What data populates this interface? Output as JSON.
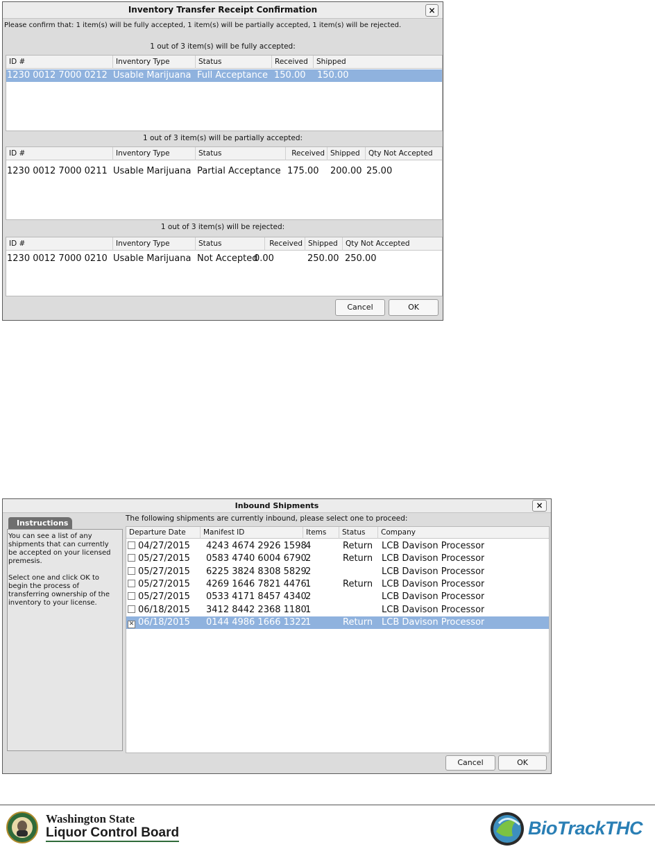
{
  "receipt_dialog": {
    "title": "Inventory Transfer Receipt Confirmation",
    "close": "×",
    "message": "Please confirm that: 1 item(s) will be fully accepted, 1 item(s) will be partially accepted, 1 item(s) will be rejected.",
    "sections": [
      {
        "label": "1 out of 3 item(s) will be fully accepted:",
        "columns": [
          "ID #",
          "Inventory Type",
          "Status",
          "Received",
          "Shipped"
        ],
        "rows": [
          [
            "1230 0012 7000 0212",
            "Usable Marijuana",
            "Full Acceptance",
            "150.00",
            "150.00"
          ]
        ]
      },
      {
        "label": "1 out of 3 item(s) will be partially accepted:",
        "columns": [
          "ID #",
          "Inventory Type",
          "Status",
          "Received",
          "Shipped",
          "Qty Not Accepted"
        ],
        "rows": [
          [
            "1230 0012 7000 0211",
            "Usable Marijuana",
            "Partial Acceptance",
            "175.00",
            "200.00",
            "25.00"
          ]
        ]
      },
      {
        "label": "1 out of 3 item(s) will be rejected:",
        "columns": [
          "ID #",
          "Inventory Type",
          "Status",
          "Received",
          "Shipped",
          "Qty Not Accepted"
        ],
        "rows": [
          [
            "1230 0012 7000 0210",
            "Usable Marijuana",
            "Not Accepted",
            "0.00",
            "250.00",
            "250.00"
          ]
        ]
      }
    ],
    "cancel_label": "Cancel",
    "ok_label": "OK"
  },
  "inbound_dialog": {
    "title": "Inbound Shipments",
    "close": "×",
    "instructions_tab": "Instructions",
    "instructions_text": "You can see a list of any\nshipments that can currently\nbe accepted on your licensed\npremesis.\n\nSelect one and click OK to\nbegin the process of\ntransferring ownership of the\ninventory to your license.",
    "prompt": "The following shipments are currently inbound, please select one to proceed:",
    "columns": [
      "Departure Date",
      "Manifest ID",
      "Items",
      "Status",
      "Company"
    ],
    "rows": [
      {
        "date": "04/27/2015",
        "manifest": "4243 4674 2926 1598",
        "items": "4",
        "status": "Return",
        "company": "LCB Davison Processor",
        "checked": false
      },
      {
        "date": "05/27/2015",
        "manifest": "0583 4740 6004 6790",
        "items": "2",
        "status": "Return",
        "company": "LCB Davison Processor",
        "checked": false
      },
      {
        "date": "05/27/2015",
        "manifest": "6225 3824 8308 5829",
        "items": "2",
        "status": "",
        "company": "LCB Davison Processor",
        "checked": false
      },
      {
        "date": "05/27/2015",
        "manifest": "4269 1646 7821 4476",
        "items": "1",
        "status": "Return",
        "company": "LCB Davison Processor",
        "checked": false
      },
      {
        "date": "05/27/2015",
        "manifest": "0533 4171 8457 4340",
        "items": "2",
        "status": "",
        "company": "LCB Davison Processor",
        "checked": false
      },
      {
        "date": "06/18/2015",
        "manifest": "3412 8442 2368 1180",
        "items": "1",
        "status": "",
        "company": "LCB Davison Processor",
        "checked": false
      },
      {
        "date": "06/18/2015",
        "manifest": "0144 4986 1666 1322",
        "items": "1",
        "status": "Return",
        "company": "LCB Davison Processor",
        "checked": true
      }
    ],
    "cancel_label": "Cancel",
    "ok_label": "OK"
  },
  "footer": {
    "left_logo_line1": "Washington State",
    "left_logo_line2": "Liquor Control Board",
    "right_logo_text": "BioTrackTHC"
  }
}
